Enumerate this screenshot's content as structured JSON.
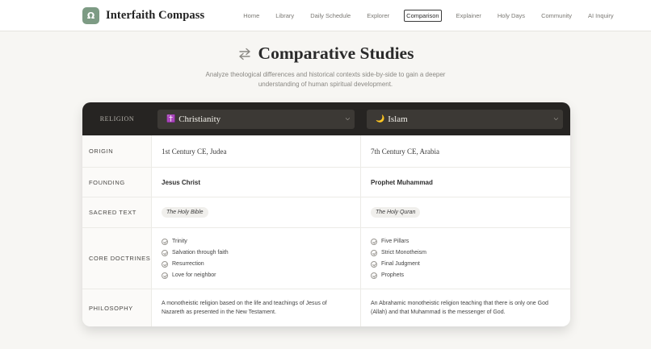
{
  "nav": {
    "logo_glyph": "Ω",
    "brand": "Interfaith Compass",
    "items": [
      "Home",
      "Library",
      "Daily Schedule",
      "Explorer",
      "Comparison",
      "Explainer",
      "Holy Days",
      "Community",
      "AI Inquiry"
    ],
    "active": "Comparison"
  },
  "hero": {
    "icon": "swap-arrows-icon",
    "title": "Comparative Studies",
    "subtitle": "Analyze theological differences and historical contexts side-by-side to gain a deeper understanding of human spiritual development."
  },
  "table": {
    "header_label": "RELIGION",
    "left": {
      "emoji": "✝️",
      "name": "Christianity",
      "origin": "1st Century CE, Judea",
      "founding": "Jesus Christ",
      "sacred_text": "The Holy Bible",
      "doctrines": [
        "Trinity",
        "Salvation through faith",
        "Resurrection",
        "Love for neighbor"
      ],
      "philosophy": "A monotheistic religion based on the life and teachings of Jesus of Nazareth as presented in the New Testament."
    },
    "right": {
      "emoji": "🌙",
      "name": "Islam",
      "origin": "7th Century CE, Arabia",
      "founding": "Prophet Muhammad",
      "sacred_text": "The Holy Quran",
      "doctrines": [
        "Five Pillars",
        "Strict Monotheism",
        "Final Judgment",
        "Prophets"
      ],
      "philosophy": "An Abrahamic monotheistic religion teaching that there is only one God (Allah) and that Muhammad is the messenger of God."
    },
    "row_labels": {
      "origin": "ORIGIN",
      "founding": "FOUNDING",
      "sacred_text": "SACRED TEXT",
      "core_doctrines": "CORE DOCTRINES",
      "philosophy": "PHILOSOPHY"
    }
  },
  "colors": {
    "accent": "#7d9b84",
    "header_bg": "#262422",
    "page_bg": "#f7f6f3"
  }
}
